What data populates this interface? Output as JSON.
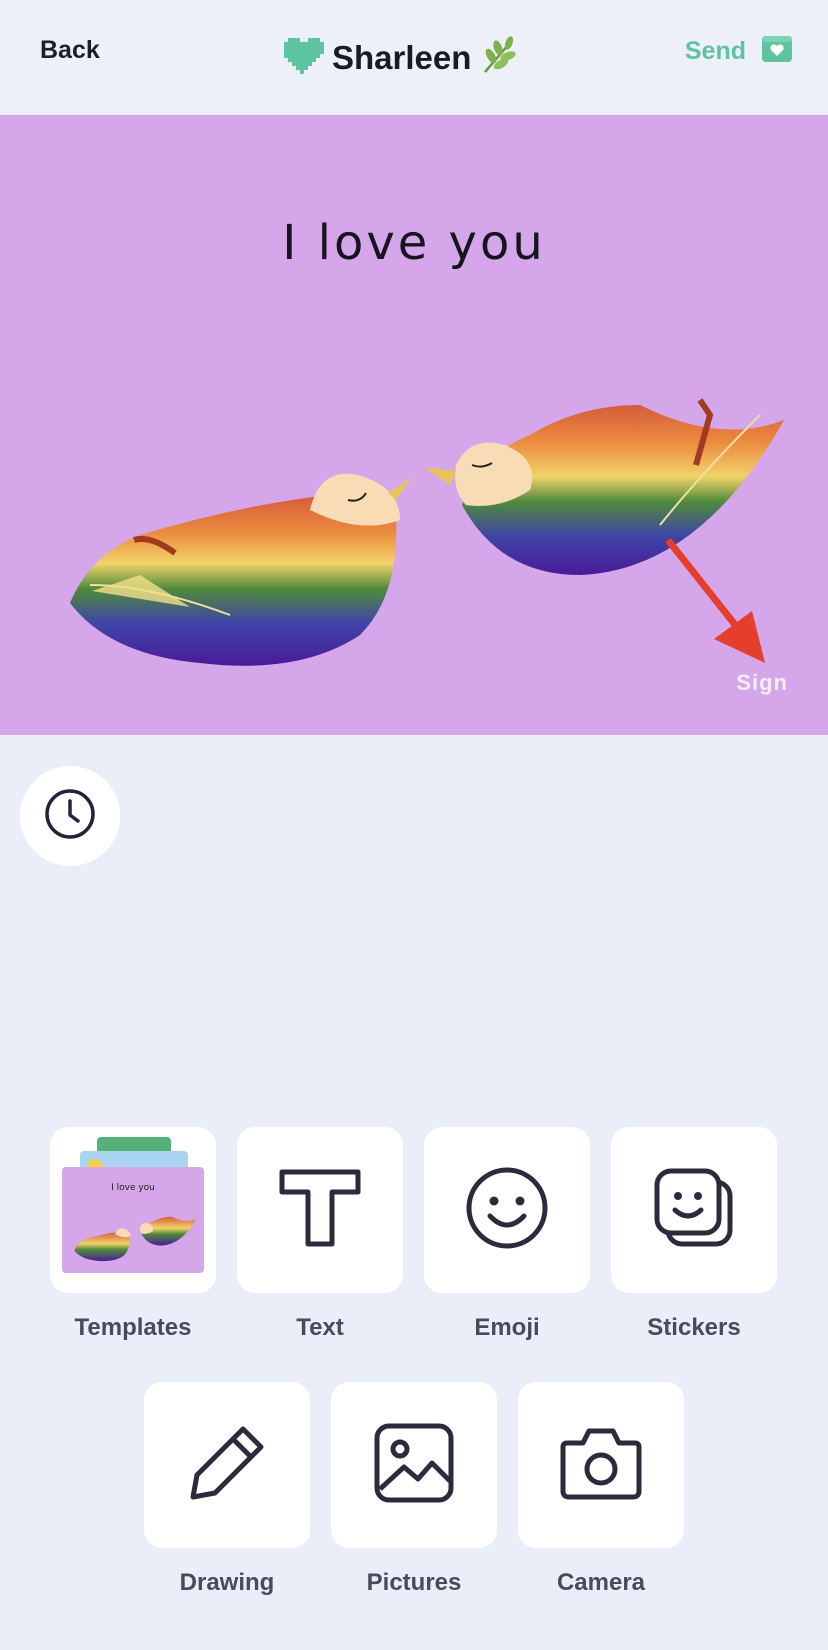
{
  "header": {
    "back_label": "Back",
    "title": "Sharleen",
    "send_label": "Send",
    "accent_color": "#5ec4a0"
  },
  "card": {
    "message": "I love you",
    "sign_label": "Sign",
    "background_color": "#d5a6e9"
  },
  "tools": {
    "row1": [
      {
        "label": "Templates",
        "icon": "templates-thumbnail"
      },
      {
        "label": "Text",
        "icon": "text-icon"
      },
      {
        "label": "Emoji",
        "icon": "smiley-icon"
      },
      {
        "label": "Stickers",
        "icon": "sticker-icon"
      }
    ],
    "row2": [
      {
        "label": "Drawing",
        "icon": "pencil-icon"
      },
      {
        "label": "Pictures",
        "icon": "image-icon"
      },
      {
        "label": "Camera",
        "icon": "camera-icon"
      }
    ]
  },
  "template_thumb_text": "I love you"
}
